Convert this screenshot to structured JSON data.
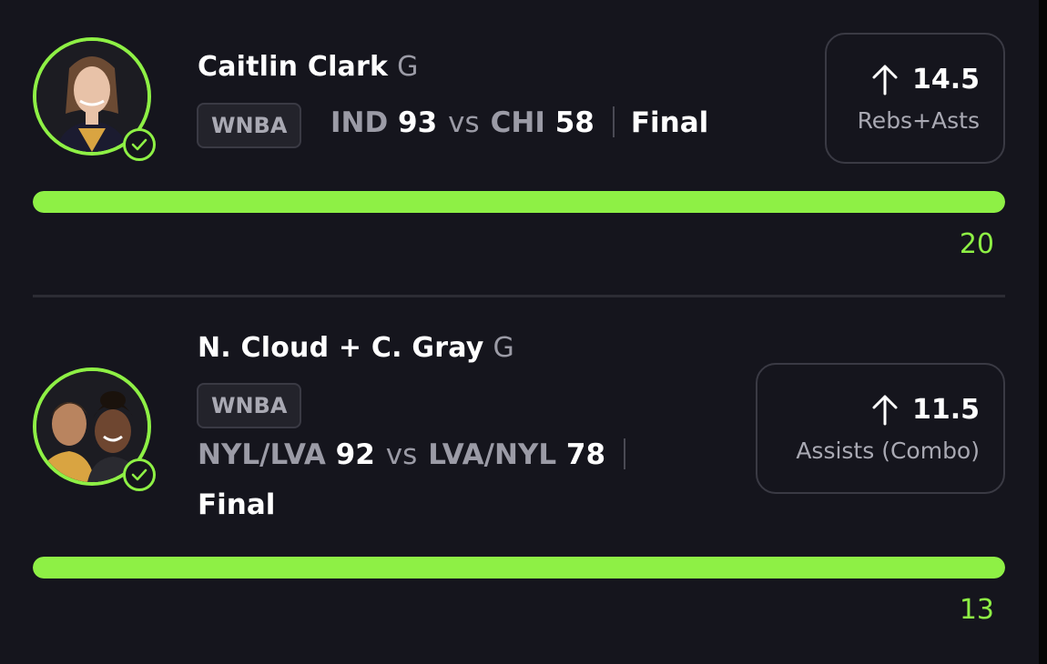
{
  "entries": [
    {
      "player": "Caitlin Clark",
      "position": "G",
      "league": "WNBA",
      "home_team": "IND",
      "home_score": "93",
      "vs": "vs",
      "away_team": "CHI",
      "away_score": "58",
      "status": "Final",
      "direction": "up-arrow-icon",
      "line": "14.5",
      "stat": "Rebs+Asts",
      "result": "20",
      "progress": 1.0
    },
    {
      "player": "N. Cloud + C. Gray",
      "position": "G",
      "league": "WNBA",
      "home_team": "NYL/LVA",
      "home_score": "92",
      "vs": "vs",
      "away_team": "LVA/NYL",
      "away_score": "78",
      "status": "Final",
      "direction": "up-arrow-icon",
      "line": "11.5",
      "stat": "Assists (Combo)",
      "result": "13",
      "progress": 1.0
    }
  ],
  "colors": {
    "accent": "#8ef045",
    "background": "#15151d",
    "muted_text": "#9b9ba6",
    "border": "#3a3a44"
  }
}
